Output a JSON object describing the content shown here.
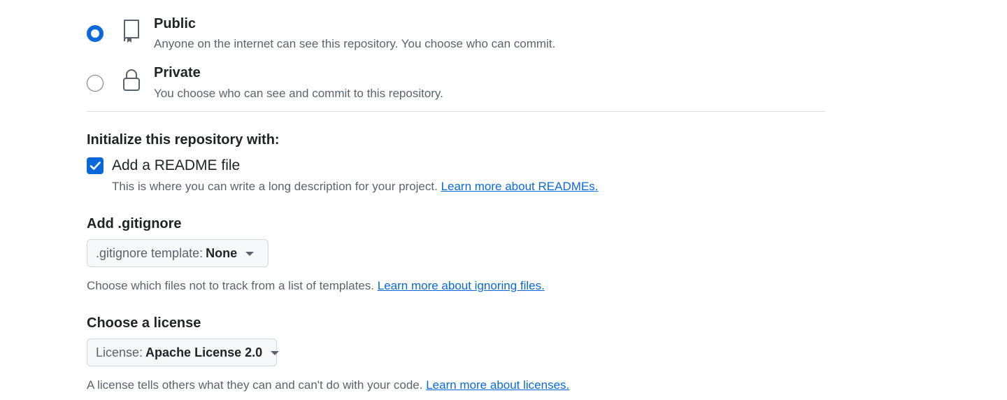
{
  "visibility": {
    "options": [
      {
        "title": "Public",
        "description": "Anyone on the internet can see this repository. You choose who can commit.",
        "selected": true,
        "icon": "repo-icon"
      },
      {
        "title": "Private",
        "description": "You choose who can see and commit to this repository.",
        "selected": false,
        "icon": "lock-icon"
      }
    ]
  },
  "initialize": {
    "heading": "Initialize this repository with:",
    "readme": {
      "label": "Add a README file",
      "checked": true,
      "description": "This is where you can write a long description for your project.",
      "link": "Learn more about READMEs."
    }
  },
  "gitignore": {
    "heading": "Add .gitignore",
    "select_prefix": ".gitignore template:",
    "select_value": "None",
    "help": "Choose which files not to track from a list of templates.",
    "link": "Learn more about ignoring files."
  },
  "license": {
    "heading": "Choose a license",
    "select_prefix": "License:",
    "select_value": "Apache License 2.0",
    "help": "A license tells others what they can and can't do with your code.",
    "link": "Learn more about licenses."
  },
  "colors": {
    "accent": "#0969da",
    "text_primary": "#1f2328",
    "text_muted": "#59636e",
    "border": "#d0d7de"
  }
}
